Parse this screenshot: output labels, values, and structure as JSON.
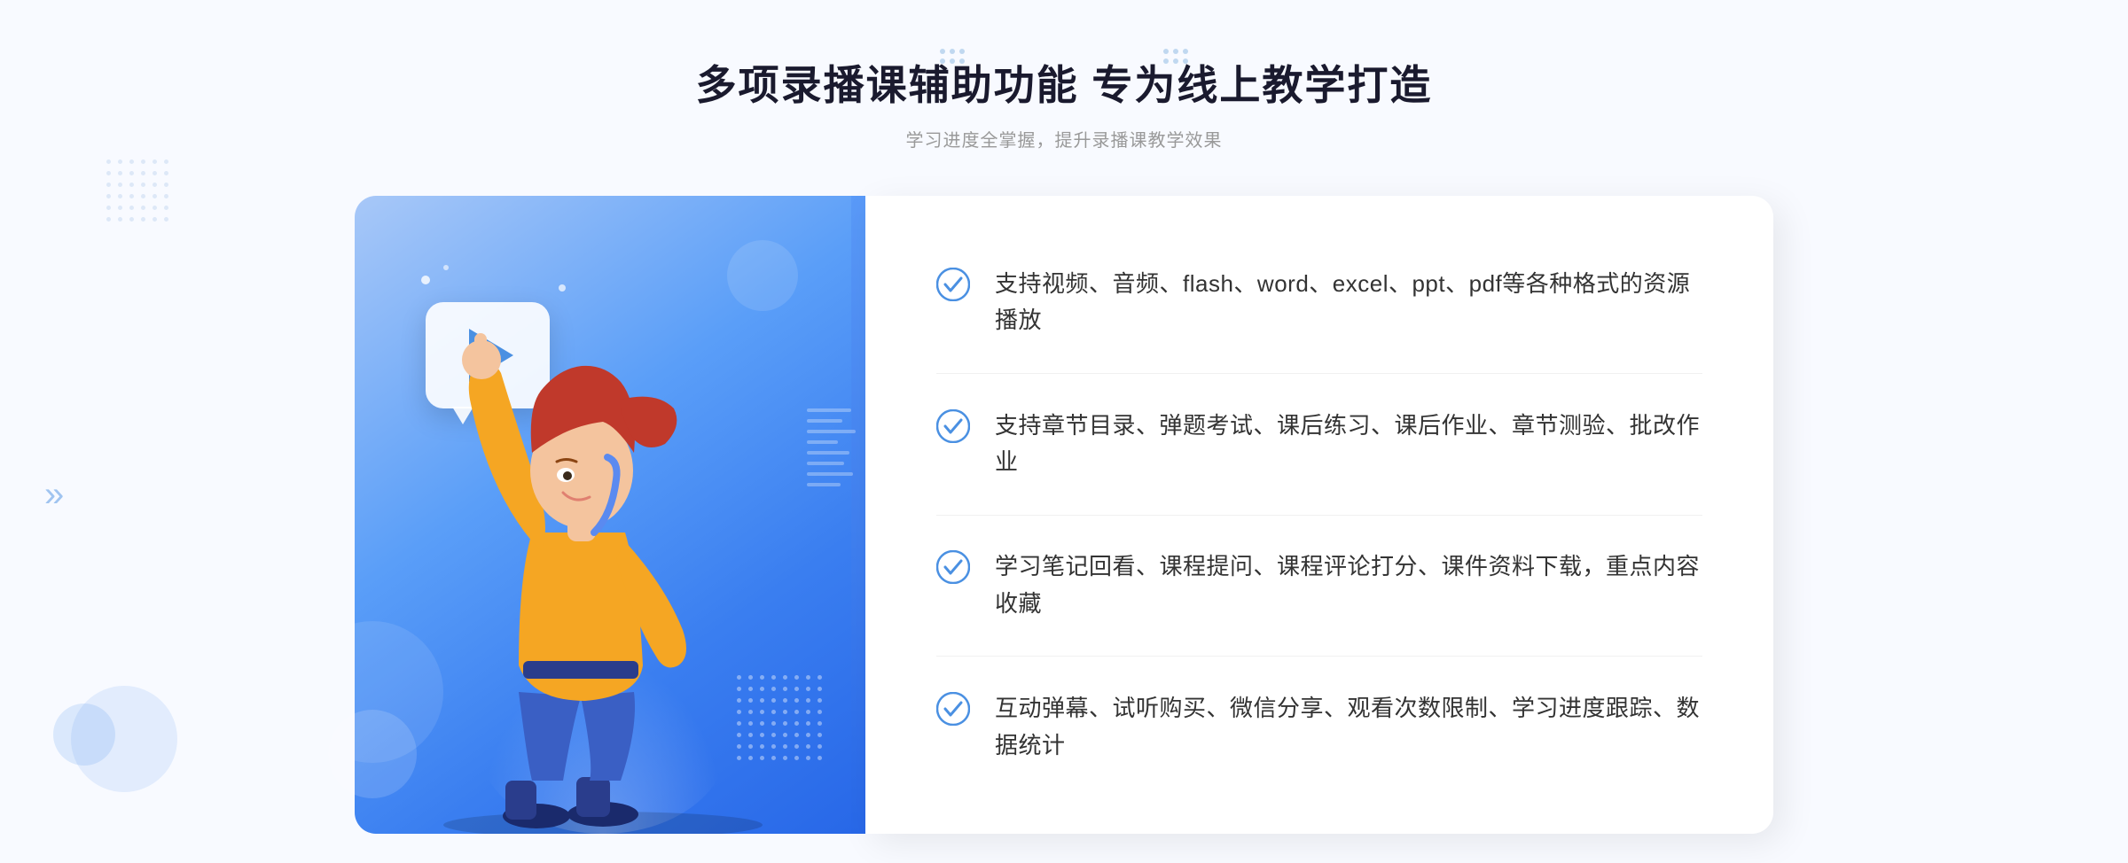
{
  "header": {
    "title": "多项录播课辅助功能 专为线上教学打造",
    "subtitle": "学习进度全掌握，提升录播课教学效果",
    "decorator_label": "decoration-dots"
  },
  "features": [
    {
      "id": 1,
      "text": "支持视频、音频、flash、word、excel、ppt、pdf等各种格式的资源播放"
    },
    {
      "id": 2,
      "text": "支持章节目录、弹题考试、课后练习、课后作业、章节测验、批改作业"
    },
    {
      "id": 3,
      "text": "学习笔记回看、课程提问、课程评论打分、课件资料下载，重点内容收藏"
    },
    {
      "id": 4,
      "text": "互动弹幕、试听购买、微信分享、观看次数限制、学习进度跟踪、数据统计"
    }
  ],
  "colors": {
    "primary_blue": "#3a7ef0",
    "light_blue": "#a8c8f8",
    "check_blue": "#4a90e2",
    "text_dark": "#1a1a2e",
    "text_gray": "#999999",
    "text_body": "#333333"
  },
  "icons": {
    "check_circle": "check-circle",
    "play": "play-triangle",
    "chevron": "chevron-right"
  }
}
